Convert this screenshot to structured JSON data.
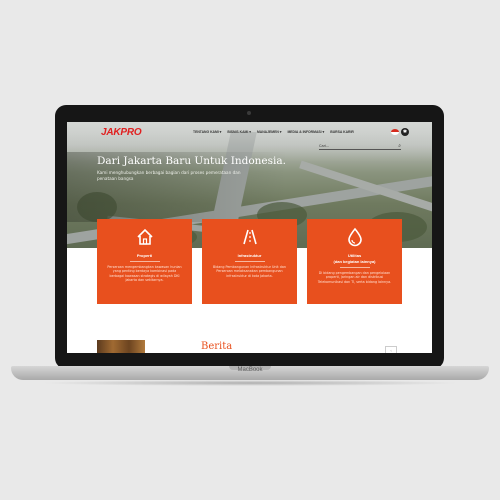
{
  "device": {
    "base_label": "MacBook"
  },
  "site": {
    "logo": "JAKPRO",
    "nav": [
      "TENTANG KAMI ▾",
      "BISNIS KAMI ▾",
      "MANAJEMEN ▾",
      "MEDIA & INFORMASI ▾",
      "BURSA KARIR"
    ],
    "search_placeholder": "Cari...",
    "hero_title": "Dari Jakarta Baru Untuk Indonesia.",
    "hero_subtitle": "Kami menghubungkan berbagai bagian dari proses pemerataan dan penataan bangsa",
    "cards": [
      {
        "title": "Properti",
        "subtitle": "",
        "icon": "house-icon",
        "desc": "Perseroan mengembangkan kawasan hunian yang penting berdaya kombinasi pada berbagai kawasan strategis di wilayah DKI Jakarta dan sekitarnya."
      },
      {
        "title": "Infrastruktur",
        "subtitle": "",
        "icon": "road-icon",
        "desc": "Bidang Pembangunan Infrastruktur Unit dan Perseroan melaksanakan pembangunan infrastruktur di kota Jakarta."
      },
      {
        "title": "Utilitas",
        "subtitle": "(dan kegiatan lainnya)",
        "icon": "water-drop-icon",
        "desc": "Di bidang pengembangan dan pengelolaan properti, jaringan air dan distribusi Telekomunikasi dan TI, serta bidang lainnya."
      }
    ],
    "section_title": "Berita",
    "pager_label": "‹"
  },
  "colors": {
    "accent": "#e8501e",
    "logo_red": "#e02020"
  }
}
